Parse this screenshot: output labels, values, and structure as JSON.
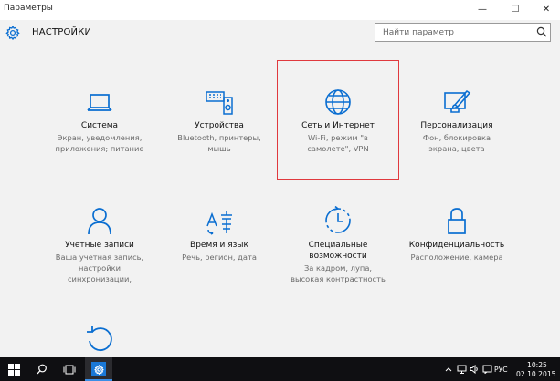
{
  "window": {
    "title": "Параметры",
    "controls": {
      "minimize": "—",
      "maximize": "☐",
      "close": "✕"
    }
  },
  "header": {
    "title": "НАСТРОЙКИ",
    "search_placeholder": "Найти параметр"
  },
  "tiles": [
    {
      "icon": "laptop-icon",
      "label": "Система",
      "desc": [
        "Экран, уведомления,",
        "приложения; питание"
      ]
    },
    {
      "icon": "devices-icon",
      "label": "Устройства",
      "desc": [
        "Bluetooth, принтеры,",
        "мышь"
      ]
    },
    {
      "icon": "globe-icon",
      "label": "Сеть и Интернет",
      "desc": [
        "Wi-Fi, режим \"в",
        "самолете\", VPN"
      ]
    },
    {
      "icon": "personalization-icon",
      "label": "Персонализация",
      "desc": [
        "Фон, блокировка",
        "экрана, цвета"
      ]
    },
    {
      "icon": "person-icon",
      "label": "Учетные записи",
      "desc": [
        "Ваша учетная запись,",
        "настройки",
        "синхронизации,"
      ]
    },
    {
      "icon": "time-language-icon",
      "label": "Время и язык",
      "desc": [
        "Речь, регион, дата"
      ]
    },
    {
      "icon": "accessibility-icon",
      "label": [
        "Специальные",
        "возможности"
      ],
      "desc": [
        "За кадром, лупа,",
        "высокая контрастность"
      ]
    },
    {
      "icon": "lock-icon",
      "label": "Конфиденциальность",
      "desc": [
        "Расположение, камера"
      ]
    },
    {
      "icon": "update-icon",
      "label": "",
      "desc": []
    }
  ],
  "colors": {
    "accent": "#0a6ed1",
    "selection": "#e0393e",
    "taskbar": "#0f0f12"
  },
  "taskbar": {
    "language": "РУС",
    "time": "10:25",
    "date": "02.10.2015"
  }
}
